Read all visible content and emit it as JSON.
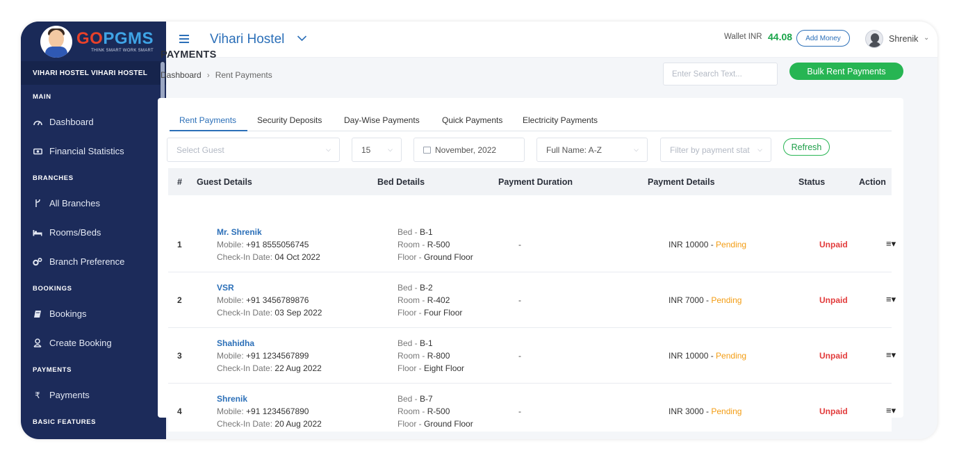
{
  "brand": {
    "go": "GO",
    "pgms": "PGMS",
    "tagline": "THINK SMART WORK SMART"
  },
  "sidebar": {
    "hostel": "VIHARI HOSTEL VIHARI HOSTEL",
    "sections": {
      "main": "MAIN",
      "branches": "BRANCHES",
      "bookings": "BOOKINGS",
      "payments": "PAYMENTS",
      "basic": "BASIC FEATURES"
    },
    "items": [
      {
        "label": "Dashboard",
        "icon": "gauge-icon"
      },
      {
        "label": "Financial Statistics",
        "icon": "money-icon"
      },
      {
        "label": "All Branches",
        "icon": "branch-icon"
      },
      {
        "label": "Rooms/Beds",
        "icon": "bed-icon"
      },
      {
        "label": "Branch Preference",
        "icon": "cogs-icon"
      },
      {
        "label": "Bookings",
        "icon": "book-icon"
      },
      {
        "label": "Create Booking",
        "icon": "user-icon"
      },
      {
        "label": "Payments",
        "icon": "rupee-icon"
      }
    ]
  },
  "header": {
    "hostel_name": "Vihari Hostel",
    "wallet_label": "Wallet INR",
    "wallet_amount": "44.08",
    "add_money": "Add Money",
    "user_name": "Shrenik"
  },
  "page": {
    "title": "PAYMENTS",
    "breadcrumb": [
      "Dashboard",
      "Rent Payments"
    ],
    "search_placeholder": "Enter Search Text...",
    "bulk_button": "Bulk Rent Payments"
  },
  "tabs": [
    "Rent Payments",
    "Security Deposits",
    "Day-Wise Payments",
    "Quick Payments",
    "Electricity Payments"
  ],
  "filters": {
    "guest_placeholder": "Select Guest",
    "page_size": "15",
    "month": "November, 2022",
    "sort": "Full Name: A-Z",
    "status_placeholder": "Filter by payment stat",
    "refresh": "Refresh"
  },
  "table": {
    "columns": [
      "#",
      "Guest Details",
      "Bed Details",
      "Payment Duration",
      "Payment Details",
      "Status",
      "Action"
    ],
    "labels": {
      "mobile": "Mobile:",
      "checkin": "Check-In Date:",
      "bed": "Bed -",
      "room": "Room -",
      "floor": "Floor -"
    },
    "rows": [
      {
        "num": "1",
        "name": "Mr. Shrenik",
        "mobile": "+91 8555056745",
        "checkin": "04 Oct 2022",
        "bed": "B-1",
        "room": "R-500",
        "floor": "Ground Floor",
        "duration": "-",
        "amount": "INR 10000 -",
        "pay_status": "Pending",
        "status": "Unpaid"
      },
      {
        "num": "2",
        "name": "VSR",
        "mobile": "+91 3456789876",
        "checkin": "03 Sep 2022",
        "bed": "B-2",
        "room": "R-402",
        "floor": "Four Floor",
        "duration": "-",
        "amount": "INR 7000 -",
        "pay_status": "Pending",
        "status": "Unpaid"
      },
      {
        "num": "3",
        "name": "Shahidha",
        "mobile": "+91 1234567899",
        "checkin": "22 Aug 2022",
        "bed": "B-1",
        "room": "R-800",
        "floor": "Eight Floor",
        "duration": "-",
        "amount": "INR 10000 -",
        "pay_status": "Pending",
        "status": "Unpaid"
      },
      {
        "num": "4",
        "name": "Shrenik",
        "mobile": "+91 1234567890",
        "checkin": "20 Aug 2022",
        "bed": "B-7",
        "room": "R-500",
        "floor": "Ground Floor",
        "duration": "-",
        "amount": "INR 3000 -",
        "pay_status": "Pending",
        "status": "Unpaid"
      }
    ]
  },
  "colors": {
    "sidebar": "#1c2b5a",
    "accent": "#2b6fb8",
    "success": "#27b553",
    "pending": "#f39c12",
    "unpaid": "#e23b3b"
  }
}
